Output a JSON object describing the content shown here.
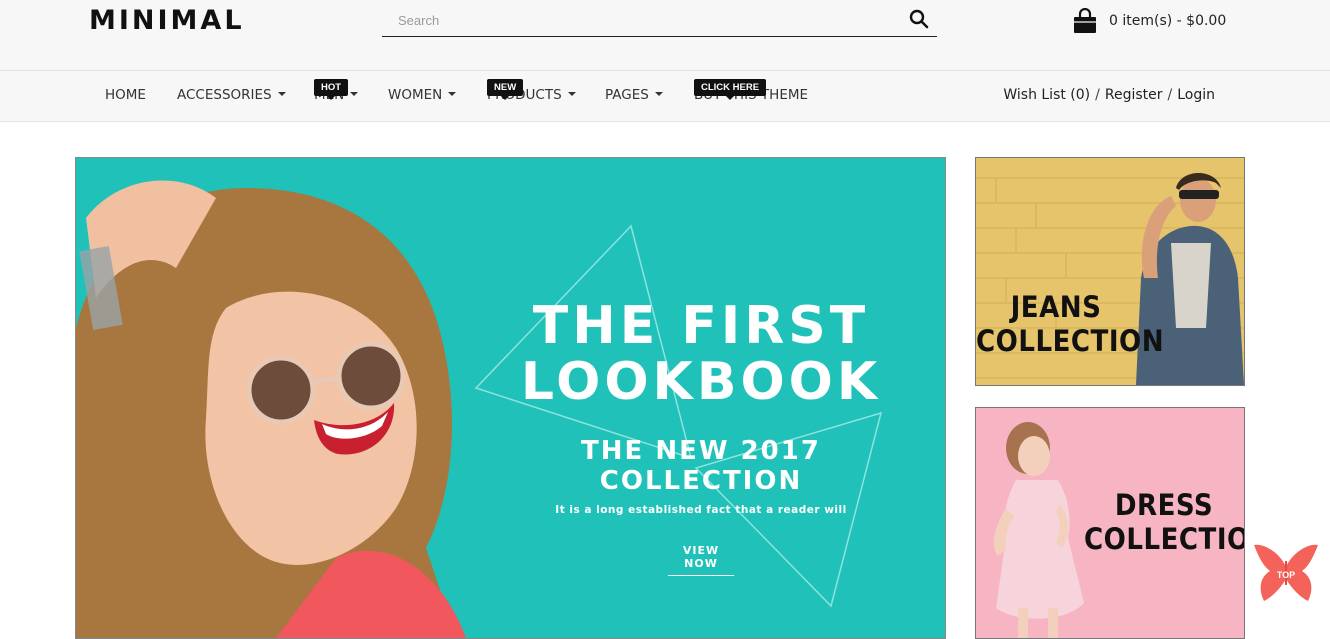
{
  "brand": {
    "logo": "MINIMAL"
  },
  "search": {
    "placeholder": "Search",
    "icon": "search-icon"
  },
  "cart": {
    "summary": "0 item(s) - $0.00",
    "icon": "shopping-bag-icon"
  },
  "nav": {
    "items": [
      {
        "label": "HOME",
        "has_dropdown": false
      },
      {
        "label": "ACCESSORIES",
        "has_dropdown": true
      },
      {
        "label": "MEN",
        "has_dropdown": true,
        "badge": "HOT"
      },
      {
        "label": "WOMEN",
        "has_dropdown": true
      },
      {
        "label": "PRODUCTS",
        "has_dropdown": true,
        "badge": "NEW"
      },
      {
        "label": "PAGES",
        "has_dropdown": true
      },
      {
        "label": "BUY THIS THEME",
        "has_dropdown": false,
        "badge": "CLICK HERE"
      }
    ]
  },
  "account": {
    "wishlist": "Wish List (0)",
    "sep": "/",
    "register": "Register",
    "login": "Login"
  },
  "hero": {
    "title_line1": "THE FIRST",
    "title_line2": "LOOKBOOK",
    "subtitle": "THE NEW 2017 COLLECTION",
    "description": "It is a long established fact that a reader will",
    "cta": "VIEW NOW",
    "background_color": "#1fc1b8"
  },
  "banners": {
    "jeans": {
      "line1": "JEANS",
      "line2": "COLLECTION",
      "background_color": "#e5c46c"
    },
    "dress": {
      "line1": "DRESS",
      "line2": "COLLECTION",
      "background_color": "#f7b5c3"
    }
  },
  "back_to_top": {
    "label": "TOP",
    "color": "#f4635a",
    "icon": "butterfly-icon"
  }
}
